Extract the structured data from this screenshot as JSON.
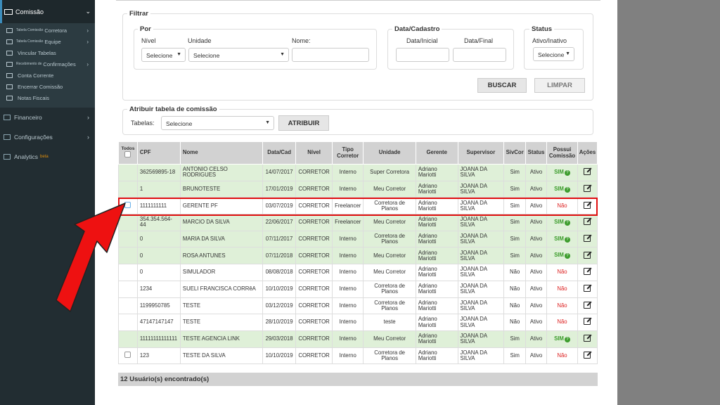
{
  "sidebar": {
    "header": "Comissão",
    "sub_items": [
      {
        "small": "Tabela Comissão",
        "label": "Corretora",
        "chev": true,
        "icon": "table-icon"
      },
      {
        "small": "Tabela Comissão",
        "label": "Equipe",
        "chev": true,
        "icon": "table-icon"
      },
      {
        "small": "",
        "label": "Vincular Tabelas",
        "chev": false,
        "icon": "link-icon"
      },
      {
        "small": "Recebimento de",
        "label": "Confirmações",
        "chev": true,
        "icon": "wrench-icon"
      },
      {
        "small": "",
        "label": "Conta Corrente",
        "chev": false,
        "icon": "account-icon"
      },
      {
        "small": "",
        "label": "Encerrar Comissão",
        "chev": false,
        "icon": "close-commission-icon"
      },
      {
        "small": "",
        "label": "Notas Fiscais",
        "chev": false,
        "icon": "invoice-icon"
      }
    ],
    "items": [
      {
        "label": "Financeiro",
        "icon": "finance-icon"
      },
      {
        "label": "Configurações",
        "icon": "gears-icon"
      },
      {
        "label": "Analytics",
        "icon": "chart-icon",
        "badge": "beta"
      }
    ]
  },
  "filter": {
    "title": "Filtrar",
    "por_title": "Por",
    "nivel_label": "Nível",
    "nivel_value": "Selecione",
    "unidade_label": "Unidade",
    "unidade_value": "Selecione",
    "nome_label": "Nome:",
    "data_title": "Data/Cadastro",
    "data_inicial_label": "Data/Inicial",
    "data_final_label": "Data/Final",
    "status_title": "Status",
    "status_label": "Ativo/Inativo",
    "status_value": "Selecione",
    "buscar": "BUSCAR",
    "limpar": "LIMPAR"
  },
  "atribuir": {
    "title": "Atribuir tabela de comissão",
    "tabelas_label": "Tabelas:",
    "tabelas_value": "Selecione",
    "button": "ATRIBUIR"
  },
  "table": {
    "headers": [
      "Todos",
      "CPF",
      "Nome",
      "Data/Cad",
      "Nível",
      "Tipo Corretor",
      "Unidade",
      "Gerente",
      "Supervisor",
      "SivCor",
      "Status",
      "Possui Comissão",
      "Ações"
    ],
    "rows": [
      {
        "cpf": "362569895-18",
        "nome": "ANTONIO CELSO RODRIGUES",
        "data": "14/07/2017",
        "nivel": "CORRETOR",
        "tipo": "Interno",
        "unidade": "Super Corretora",
        "gerente": "Adriano Mariotti",
        "supervisor": "JOANA DA SILVA",
        "sivcor": "Sim",
        "status": "Ativo",
        "comissao": "SIM",
        "checkbox": false,
        "green": true
      },
      {
        "cpf": "1",
        "nome": "BRUNOTESTE",
        "data": "17/01/2019",
        "nivel": "CORRETOR",
        "tipo": "Interno",
        "unidade": "Meu Corretor",
        "gerente": "Adriano Mariotti",
        "supervisor": "JOANA DA SILVA",
        "sivcor": "Sim",
        "status": "Ativo",
        "comissao": "SIM",
        "checkbox": false,
        "green": true
      },
      {
        "cpf": "1111111111",
        "nome": "GERENTE PF",
        "data": "03/07/2019",
        "nivel": "CORRETOR",
        "tipo": "Freelancer",
        "unidade": "Corretora de Planos",
        "gerente": "Adriano Mariotti",
        "supervisor": "JOANA DA SILVA",
        "sivcor": "Sim",
        "status": "Ativo",
        "comissao": "Não",
        "checkbox": true,
        "green": false
      },
      {
        "cpf": "354.354.564-44",
        "nome": "MARCIO DA SILVA",
        "data": "22/06/2017",
        "nivel": "CORRETOR",
        "tipo": "Freelancer",
        "unidade": "Meu Corretor",
        "gerente": "Adriano Mariotti",
        "supervisor": "JOANA DA SILVA",
        "sivcor": "Sim",
        "status": "Ativo",
        "comissao": "SIM",
        "checkbox": false,
        "green": true
      },
      {
        "cpf": "0",
        "nome": "MARIA DA SILVA",
        "data": "07/11/2017",
        "nivel": "CORRETOR",
        "tipo": "Interno",
        "unidade": "Corretora de Planos",
        "gerente": "Adriano Mariotti",
        "supervisor": "JOANA DA SILVA",
        "sivcor": "Sim",
        "status": "Ativo",
        "comissao": "SIM",
        "checkbox": false,
        "green": true
      },
      {
        "cpf": "0",
        "nome": "ROSA ANTUNES",
        "data": "07/11/2018",
        "nivel": "CORRETOR",
        "tipo": "Interno",
        "unidade": "Meu Corretor",
        "gerente": "Adriano Mariotti",
        "supervisor": "JOANA DA SILVA",
        "sivcor": "Sim",
        "status": "Ativo",
        "comissao": "SIM",
        "checkbox": false,
        "green": true
      },
      {
        "cpf": "0",
        "nome": "SIMULADOR",
        "data": "08/08/2018",
        "nivel": "CORRETOR",
        "tipo": "Interno",
        "unidade": "Meu Corretor",
        "gerente": "Adriano Mariotti",
        "supervisor": "JOANA DA SILVA",
        "sivcor": "Não",
        "status": "Ativo",
        "comissao": "Não",
        "checkbox": false,
        "green": false
      },
      {
        "cpf": "1234",
        "nome": "SUELI FRANCISCA CORRêA",
        "data": "10/10/2019",
        "nivel": "CORRETOR",
        "tipo": "Interno",
        "unidade": "Corretora de Planos",
        "gerente": "Adriano Mariotti",
        "supervisor": "JOANA DA SILVA",
        "sivcor": "Não",
        "status": "Ativo",
        "comissao": "Não",
        "checkbox": false,
        "green": false
      },
      {
        "cpf": "1199950785",
        "nome": "TESTE",
        "data": "03/12/2019",
        "nivel": "CORRETOR",
        "tipo": "Interno",
        "unidade": "Corretora de Planos",
        "gerente": "Adriano Mariotti",
        "supervisor": "JOANA DA SILVA",
        "sivcor": "Não",
        "status": "Ativo",
        "comissao": "Não",
        "checkbox": false,
        "green": false
      },
      {
        "cpf": "47147147147",
        "nome": "TESTE",
        "data": "28/10/2019",
        "nivel": "CORRETOR",
        "tipo": "Interno",
        "unidade": "teste",
        "gerente": "Adriano Mariotti",
        "supervisor": "JOANA DA SILVA",
        "sivcor": "Não",
        "status": "Ativo",
        "comissao": "Não",
        "checkbox": false,
        "green": false
      },
      {
        "cpf": "11111111111111",
        "nome": "TESTE AGENCIA LINK",
        "data": "29/03/2018",
        "nivel": "CORRETOR",
        "tipo": "Interno",
        "unidade": "Meu Corretor",
        "gerente": "Adriano Mariotti",
        "supervisor": "JOANA DA SILVA",
        "sivcor": "Sim",
        "status": "Ativo",
        "comissao": "SIM",
        "checkbox": false,
        "green": true
      },
      {
        "cpf": "123",
        "nome": "TESTE DA SILVA",
        "data": "10/10/2019",
        "nivel": "CORRETOR",
        "tipo": "Interno",
        "unidade": "Corretora de Planos",
        "gerente": "Adriano Mariotti",
        "supervisor": "JOANA DA SILVA",
        "sivcor": "Sim",
        "status": "Ativo",
        "comissao": "Não",
        "checkbox": true,
        "green": false
      }
    ]
  },
  "footer": "12 Usuário(s) encontrado(s)",
  "colors": {
    "sidebar": "#222d32",
    "row_green": "#dff0d8",
    "highlight": "#e01010",
    "sim": "#3c9c2c"
  }
}
